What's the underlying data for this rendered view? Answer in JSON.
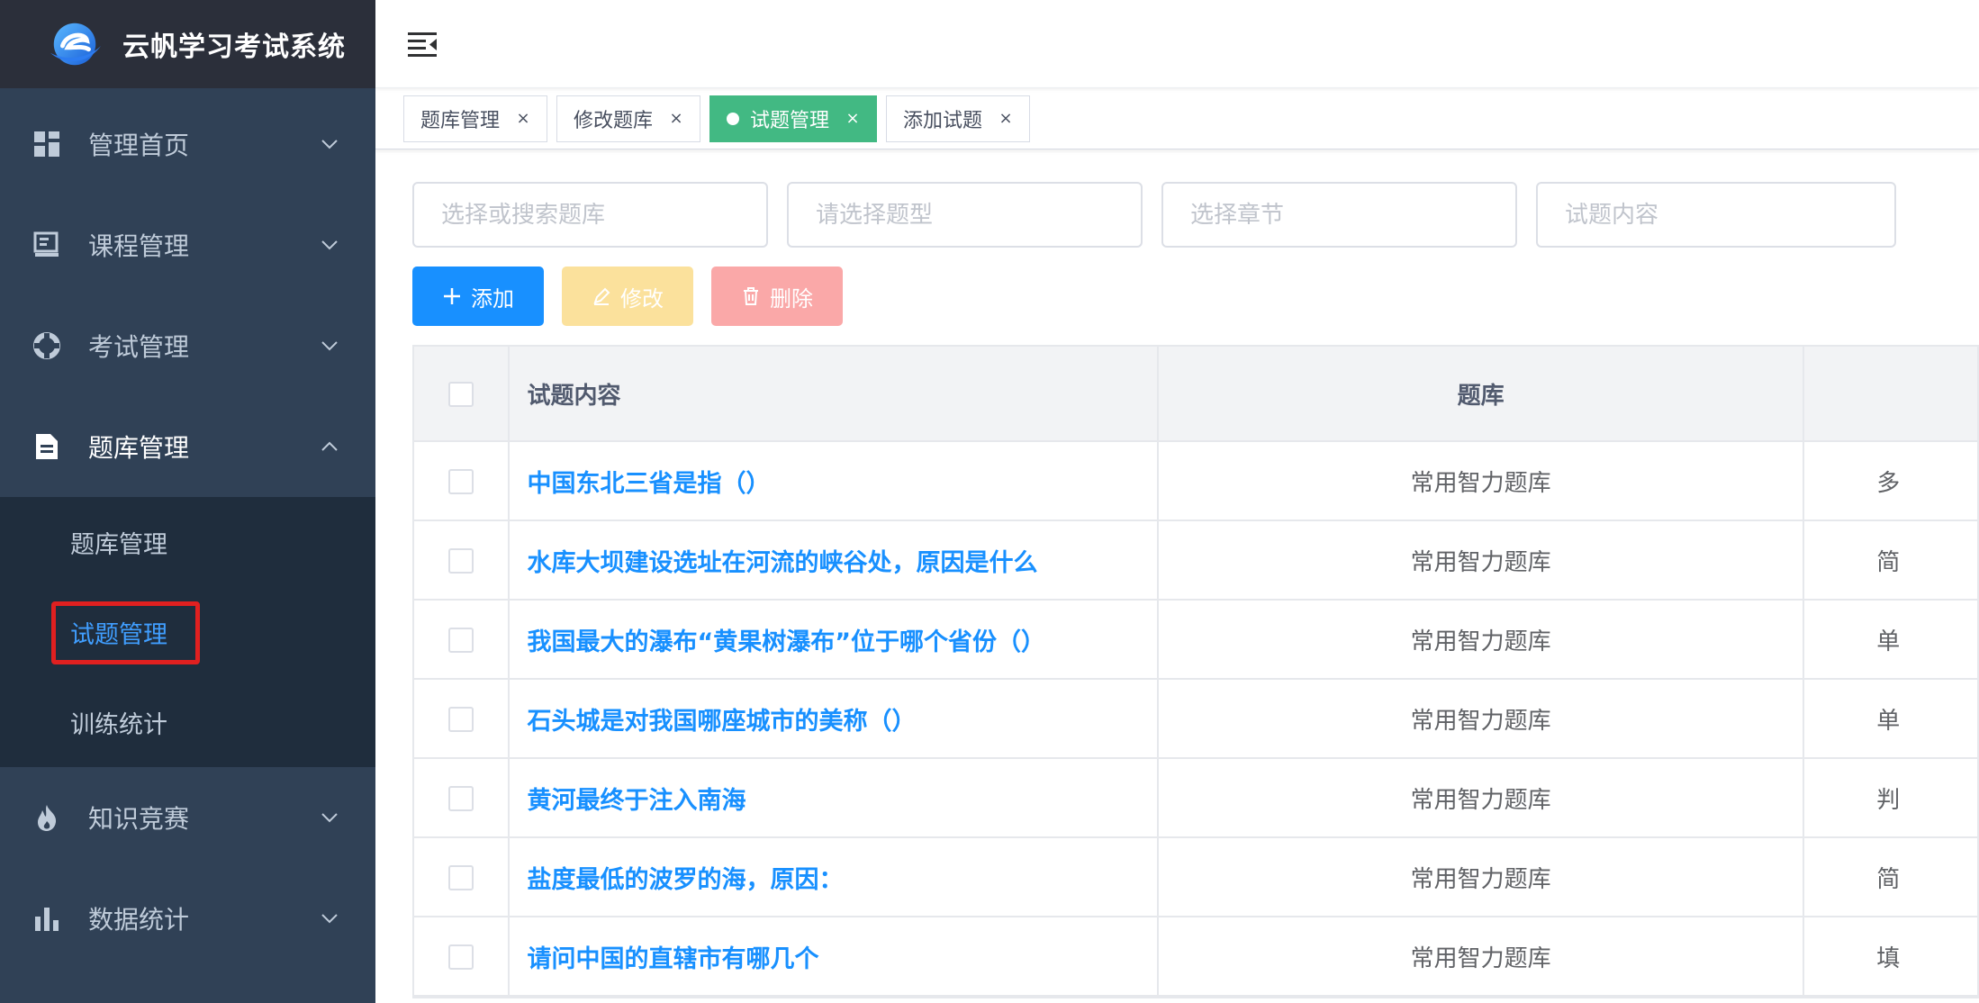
{
  "app": {
    "title": "云帆学习考试系统"
  },
  "sidebar": {
    "items": [
      {
        "label": "管理首页",
        "icon": "dashboard-icon"
      },
      {
        "label": "课程管理",
        "icon": "book-icon"
      },
      {
        "label": "考试管理",
        "icon": "lifebuoy-icon"
      },
      {
        "label": "题库管理",
        "icon": "document-icon"
      },
      {
        "label": "知识竞赛",
        "icon": "fire-icon"
      },
      {
        "label": "数据统计",
        "icon": "bar-chart-icon"
      }
    ],
    "submenu": [
      {
        "label": "题库管理"
      },
      {
        "label": "试题管理"
      },
      {
        "label": "训练统计"
      }
    ]
  },
  "tags": [
    {
      "label": "题库管理",
      "close": "×"
    },
    {
      "label": "修改题库",
      "close": "×"
    },
    {
      "label": "试题管理",
      "close": "×"
    },
    {
      "label": "添加试题",
      "close": "×"
    }
  ],
  "filters": {
    "bank_placeholder": "选择或搜索题库",
    "type_placeholder": "请选择题型",
    "chapter_placeholder": "选择章节",
    "content_placeholder": "试题内容"
  },
  "toolbar": {
    "add_label": "添加",
    "edit_label": "修改",
    "delete_label": "删除"
  },
  "table": {
    "headers": {
      "content": "试题内容",
      "bank": "题库"
    },
    "rows": [
      {
        "content": "中国东北三省是指（）",
        "bank": "常用智力题库",
        "type": "多"
      },
      {
        "content": "水库大坝建设选址在河流的峡谷处，原因是什么",
        "bank": "常用智力题库",
        "type": "简"
      },
      {
        "content": "我国最大的瀑布“黄果树瀑布”位于哪个省份（）",
        "bank": "常用智力题库",
        "type": "单"
      },
      {
        "content": "石头城是对我国哪座城市的美称（）",
        "bank": "常用智力题库",
        "type": "单"
      },
      {
        "content": "黄河最终于注入南海",
        "bank": "常用智力题库",
        "type": "判"
      },
      {
        "content": "盐度最低的波罗的海，原因：",
        "bank": "常用智力题库",
        "type": "简"
      },
      {
        "content": "请问中国的直辖市有哪几个",
        "bank": "常用智力题库",
        "type": "填"
      }
    ]
  },
  "colors": {
    "sidebar_bg": "#304156",
    "brand_bg": "#2b2f3a",
    "accent": "#1890ff",
    "tag_active": "#42b983",
    "highlight_box": "#e02020"
  }
}
